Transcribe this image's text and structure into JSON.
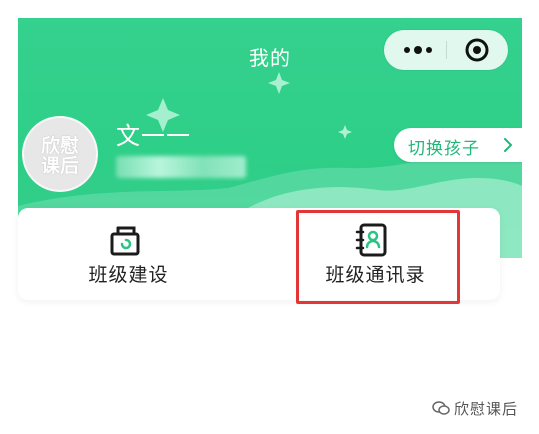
{
  "header": {
    "title": "我的",
    "background_color": "#34CF8B"
  },
  "capsule": {
    "more_icon": "more-dots-icon",
    "close_icon": "target-close-icon"
  },
  "profile": {
    "avatar_text": "欣慰\n课后",
    "name": "文一一"
  },
  "switch_child": {
    "label": "切换孩子",
    "icon": "chevron-right-icon",
    "accent_color": "#20B77A"
  },
  "menu": {
    "items": [
      {
        "label": "班级建设",
        "icon": "class-building-icon"
      },
      {
        "label": "班级通讯录",
        "icon": "address-book-icon"
      }
    ]
  },
  "highlight": {
    "color": "#E13737",
    "target": "班级通讯录"
  },
  "watermark": {
    "text": "欣慰课后",
    "icon": "wechat-icon"
  }
}
